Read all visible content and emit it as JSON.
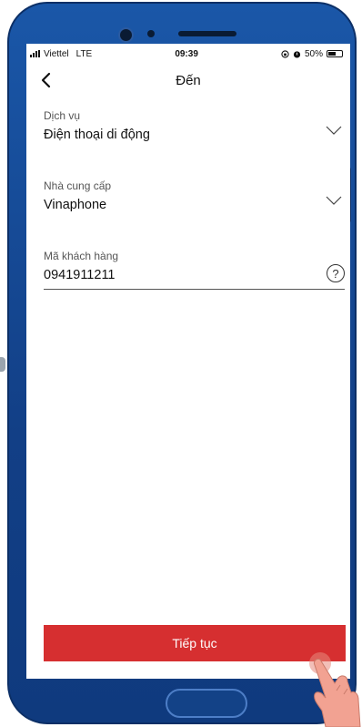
{
  "status_bar": {
    "carrier": "Viettel",
    "network": "LTE",
    "time": "09:39",
    "battery": "50%",
    "battery_level": 0.5
  },
  "header": {
    "title": "Đến"
  },
  "form": {
    "service": {
      "label": "Dịch vụ",
      "value": "Điện thoại di động"
    },
    "provider": {
      "label": "Nhà cung cấp",
      "value": "Vinaphone"
    },
    "customer_code": {
      "label": "Mã khách hàng",
      "value": "0941911211"
    }
  },
  "actions": {
    "continue_label": "Tiếp tục"
  },
  "icons": {
    "help": "?"
  },
  "colors": {
    "primary_button": "#d62f30",
    "phone_frame": "#1a57a8"
  }
}
